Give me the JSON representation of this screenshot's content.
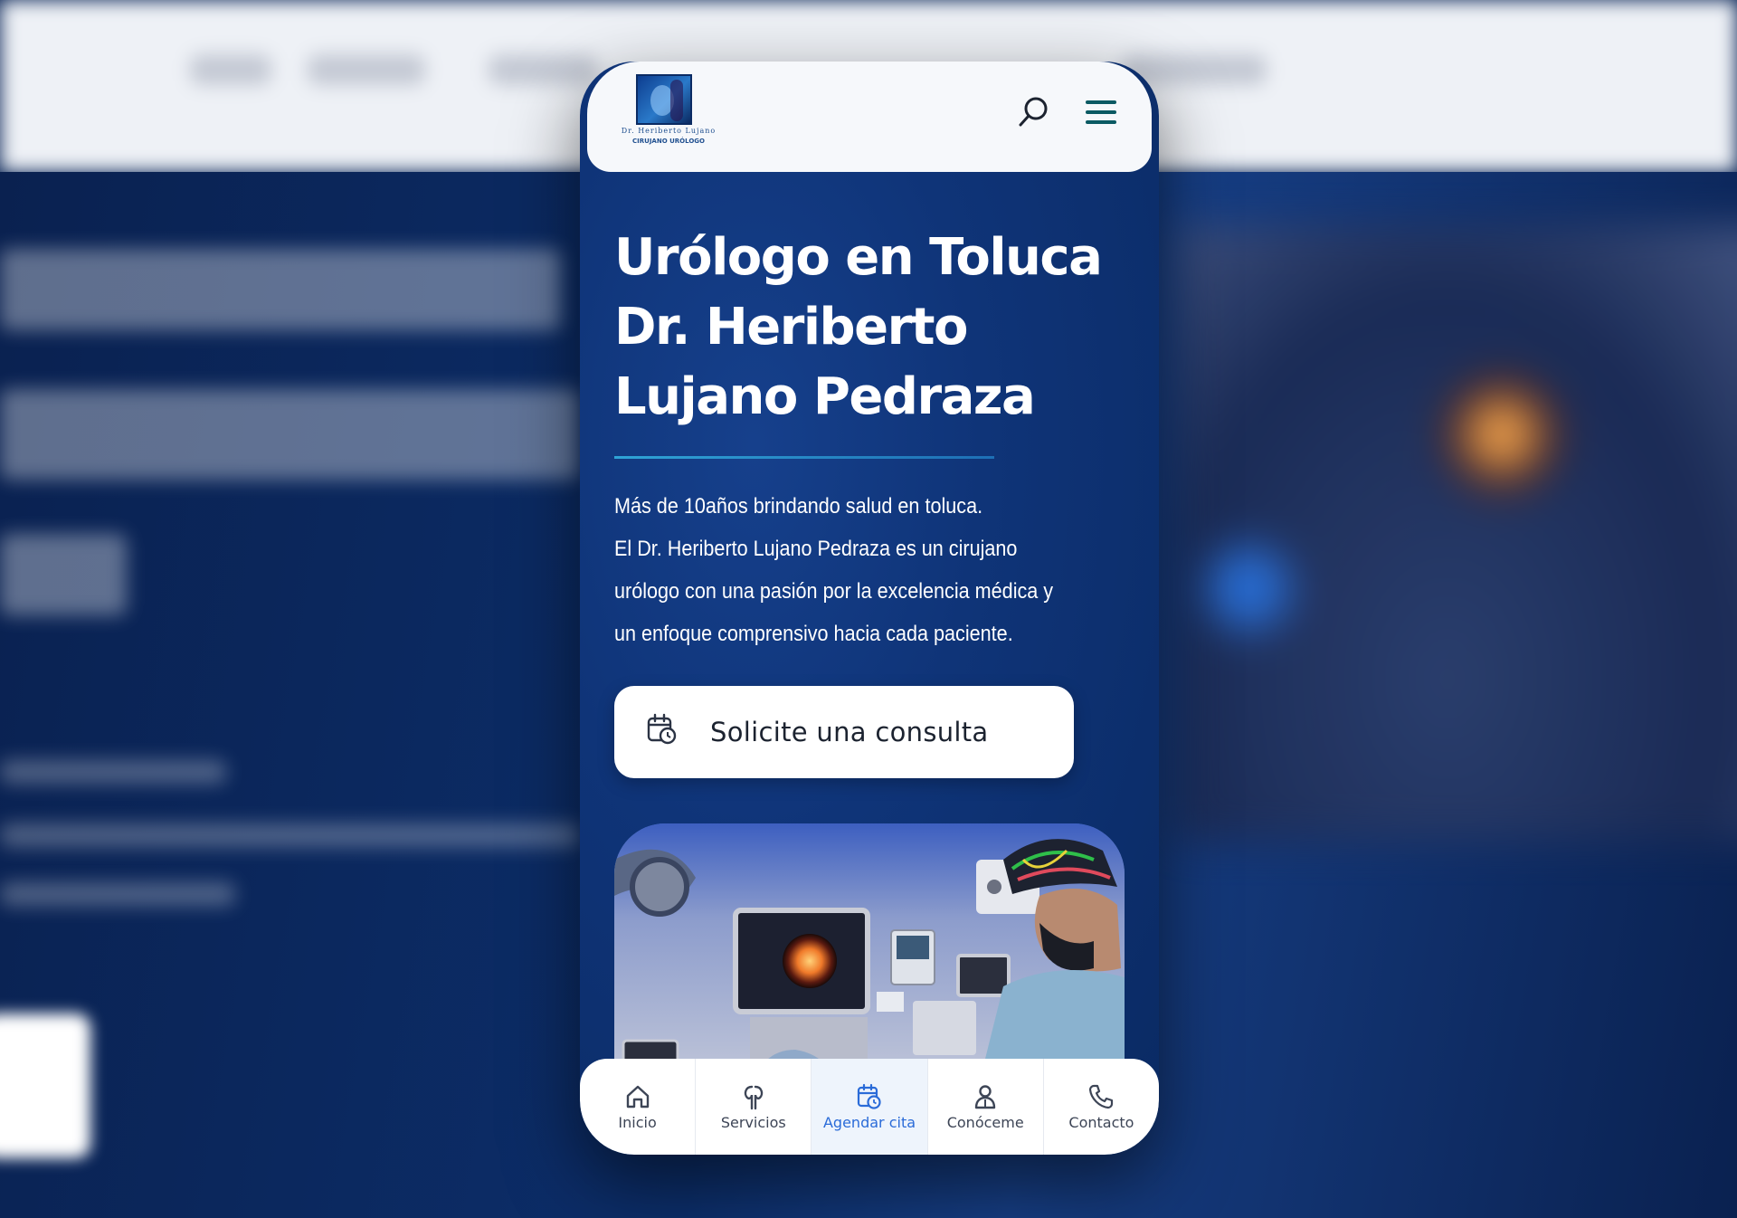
{
  "brand": {
    "logo_line1": "Dr. Heriberto Lujano",
    "logo_line2": "CIRUJANO URÓLOGO"
  },
  "header": {
    "search_icon": "search-icon",
    "menu_icon": "hamburger-menu-icon"
  },
  "hero": {
    "title_lines": [
      "Urólogo en Toluca",
      "Dr. Heriberto",
      "Lujano Pedraza"
    ],
    "description_lines": [
      "Más de 10años brindando salud en toluca.",
      "El Dr. Heriberto Lujano Pedraza es un cirujano",
      "urólogo con una pasión por la excelencia médica y",
      "un enfoque comprensivo hacia cada paciente."
    ],
    "cta_label": "Solicite una consulta",
    "cta_icon": "calendar-clock-icon"
  },
  "bottom_nav": [
    {
      "label": "Inicio",
      "icon": "home-icon",
      "active": false
    },
    {
      "label": "Servicios",
      "icon": "kidneys-icon",
      "active": false
    },
    {
      "label": "Agendar cita",
      "icon": "calendar-clock-icon",
      "active": true
    },
    {
      "label": "Conóceme",
      "icon": "doctor-icon",
      "active": false
    },
    {
      "label": "Contacto",
      "icon": "phone-icon",
      "active": false
    }
  ],
  "colors": {
    "hero_bg": "#0f3478",
    "accent_active": "#2a6bd8",
    "menu_icon": "#0b5a63",
    "title_rule": "#2fa3d6"
  }
}
